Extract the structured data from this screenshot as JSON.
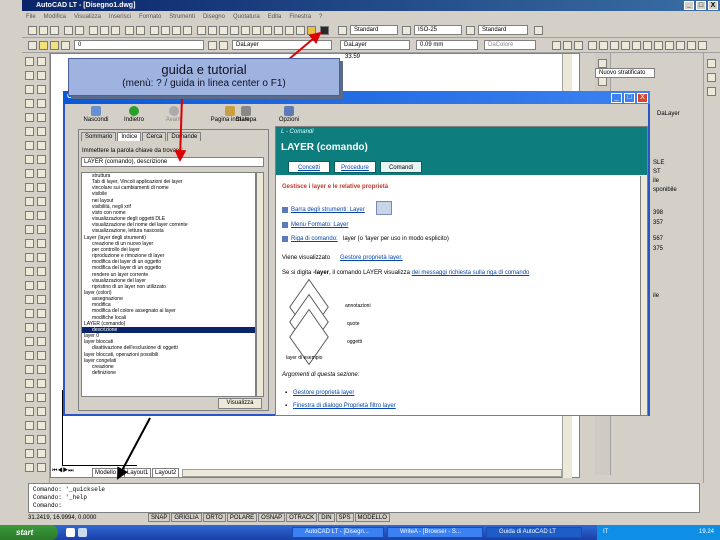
{
  "window": {
    "title": "AutoCAD LT - [Disegno1.dwg]",
    "min_label": "_",
    "max_label": "□",
    "close_label": "X"
  },
  "menubar": [
    "File",
    "Modifica",
    "Visualizza",
    "Inserisci",
    "Formato",
    "Strumenti",
    "Disegno",
    "Quotatura",
    "Edita",
    "Finestra",
    "?"
  ],
  "toolbar": {
    "text_style": "Standard",
    "dim_style": "ISO-25",
    "table_style": "Standard",
    "layer_combo": "0",
    "color_combo": "DaLayer",
    "linetype_combo": "DaLayer",
    "lineweight_combo": "0.09 mm",
    "plotstyle_combo": "DaColore",
    "coord_value": "33.59"
  },
  "callout": {
    "line1": "guida e tutorial",
    "line2": "(menù: ? / guida in linea center o F1)"
  },
  "right_palette": {
    "style_combo": "Nuovo stratificato",
    "layer_combo": "DaLayer",
    "list1": [
      "SLE",
      "ST",
      "ile",
      "sponibile"
    ],
    "list2": [
      "398",
      "357",
      "567",
      "375"
    ],
    "footer": "ile"
  },
  "help": {
    "title": "Guida di AutoCAD LT",
    "toolbar": [
      "Nascondi",
      "Indietro",
      "Avanti",
      "Pagina iniziale",
      "Stampa",
      "Opzioni"
    ],
    "tabs": [
      "Sommario",
      "Indice",
      "Cerca",
      "Domande"
    ],
    "search_label": "Immettere la parola chiave da trovare:",
    "search_value": "LAYER (comando), descrizione",
    "index_items": [
      {
        "text": "struttura",
        "sel": false
      },
      {
        "text": "Tab di layer, Vincoli applicazioni dei layer",
        "sel": false
      },
      {
        "text": "vincolare sui cambiamenti di nome",
        "sel": false
      },
      {
        "text": "visibile",
        "sel": false
      },
      {
        "text": "nei layout",
        "sel": false
      },
      {
        "text": "visibilità, negli xrif",
        "sel": false
      },
      {
        "text": "visto con nome",
        "sel": false
      },
      {
        "text": "visualizzazione degli oggetti DLE",
        "sel": false
      },
      {
        "text": "visualizzazione del nome del layer corrente",
        "sel": false
      },
      {
        "text": "visualizzazione, lettura nascosta",
        "sel": false
      },
      {
        "text": "Layer (layer degli strumenti)",
        "sel": false
      },
      {
        "text": "creazione di un nuovo layer",
        "sel": false
      },
      {
        "text": "per controllo dei layer",
        "sel": false
      },
      {
        "text": "riproduzione e rimozione di layer",
        "sel": false
      },
      {
        "text": "modifica dei layer di un oggetto",
        "sel": false
      },
      {
        "text": "modifica del layer di un oggetto",
        "sel": false
      },
      {
        "text": "rendere un layer corrente",
        "sel": false
      },
      {
        "text": "visualizzazione del layer",
        "sel": false
      },
      {
        "text": "ripristino di un layer non utilizzato",
        "sel": false
      },
      {
        "text": "layer (colori)",
        "sel": false
      },
      {
        "text": "assegnazione",
        "sel": false
      },
      {
        "text": "modifica",
        "sel": false
      },
      {
        "text": "modifica del colore assegnato ai layer",
        "sel": false
      },
      {
        "text": "modifiche locali",
        "sel": false
      },
      {
        "text": "LAYER (comando)",
        "sel": false
      },
      {
        "text": "descrizione",
        "sel": true
      },
      {
        "text": "layer 0",
        "sel": false
      },
      {
        "text": "layer bloccati",
        "sel": false
      },
      {
        "text": "disattivazione dell'esclusione di oggetti",
        "sel": false
      },
      {
        "text": "layer bloccati, operazioni possibili",
        "sel": false
      },
      {
        "text": "layer congelati",
        "sel": false
      },
      {
        "text": "creazione",
        "sel": false
      },
      {
        "text": "definizione",
        "sel": false
      }
    ],
    "display_button": "Visualizza",
    "content": {
      "breadcrumb": "L - Comandi",
      "title": "LAYER (comando)",
      "tabs": [
        "Concetti",
        "Procedure",
        "Comandi"
      ],
      "intro": "Gestisce i layer e le relative proprietà",
      "access_toolbar": "Barra degli strumenti: Layer",
      "access_menu": "Menu Formato: Layer",
      "access_cmd_label": "Riga di comando:",
      "access_cmd_value": "layer (o 'layer per uso in modo esplicito)",
      "viene_label": "Viene visualizzato",
      "viene_link": "Gestore proprietà layer.",
      "note_prefix": "Se si digita",
      "note_cmd": "-layer",
      "note_mid": ", il comando LAYER visualizza",
      "note_link": "dei messaggi richiesta sulla riga di comando",
      "diagram_labels": [
        "annotazioni",
        "quote",
        "oggetti",
        "layer di esempio"
      ],
      "related_heading": "Argomenti di questa sezione:",
      "related": [
        "Gestore proprietà layer",
        "Finestra di dialogo Proprietà filtro layer"
      ]
    }
  },
  "layout_tabs": [
    "Modello",
    "Layout1",
    "Layout2"
  ],
  "command_lines": [
    "Comando: '_quicksele",
    "Comando: '_help",
    "Comando:"
  ],
  "status": {
    "coords": "31.2419, 16.9994, 0.0000",
    "toggles": [
      "SNAP",
      "GRIGLIA",
      "ORTO",
      "POLARE",
      "OSNAP",
      "OTRACK",
      "DIN",
      "SPS",
      "MODELLO"
    ]
  },
  "taskbar": {
    "start": "start",
    "tasks": [
      "AutoCAD LT - [Disegn...",
      "WriteA - [Browser - S...",
      "Guida di AutoCAD LT"
    ],
    "lang": "IT",
    "time": "19.24"
  },
  "colors": {
    "help_header": "#0e7d7d",
    "link": "#0645ad",
    "callout_bg": "#9fb3e0",
    "title_bar": "#0a246a"
  }
}
